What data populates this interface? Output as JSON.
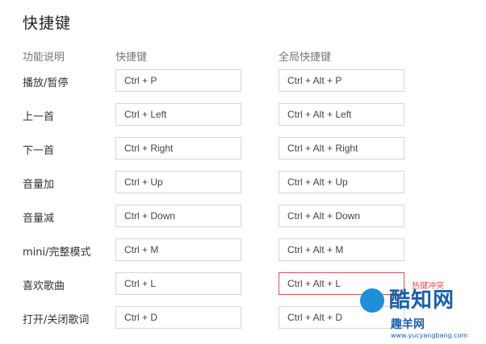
{
  "page": {
    "title": "快捷键"
  },
  "headers": {
    "function": "功能说明",
    "local": "快捷键",
    "global": "全局快捷键"
  },
  "rows": [
    {
      "label": "播放/暂停",
      "local": "Ctrl + P",
      "global": "Ctrl + Alt + P"
    },
    {
      "label": "上一首",
      "local": "Ctrl + Left",
      "global": "Ctrl + Alt + Left"
    },
    {
      "label": "下一首",
      "local": "Ctrl + Right",
      "global": "Ctrl + Alt + Right"
    },
    {
      "label": "音量加",
      "local": "Ctrl + Up",
      "global": "Ctrl + Alt + Up"
    },
    {
      "label": "音量减",
      "local": "Ctrl + Down",
      "global": "Ctrl + Alt + Down"
    },
    {
      "label": "mini/完整模式",
      "local": "Ctrl + M",
      "global": "Ctrl + Alt + M"
    },
    {
      "label": "喜欢歌曲",
      "local": "Ctrl + L",
      "global": "Ctrl + Alt + L",
      "conflict": "热键冲突"
    },
    {
      "label": "打开/关闭歌词",
      "local": "Ctrl + D",
      "global": "Ctrl + Alt + D"
    }
  ],
  "watermark": {
    "brand": "酷知网",
    "site": "趣羊网",
    "url": "www.yucyangbang.com"
  },
  "colors": {
    "conflict_border": "#d9534f",
    "conflict_text": "#e34b4b",
    "watermark": "#1a5fa8"
  }
}
